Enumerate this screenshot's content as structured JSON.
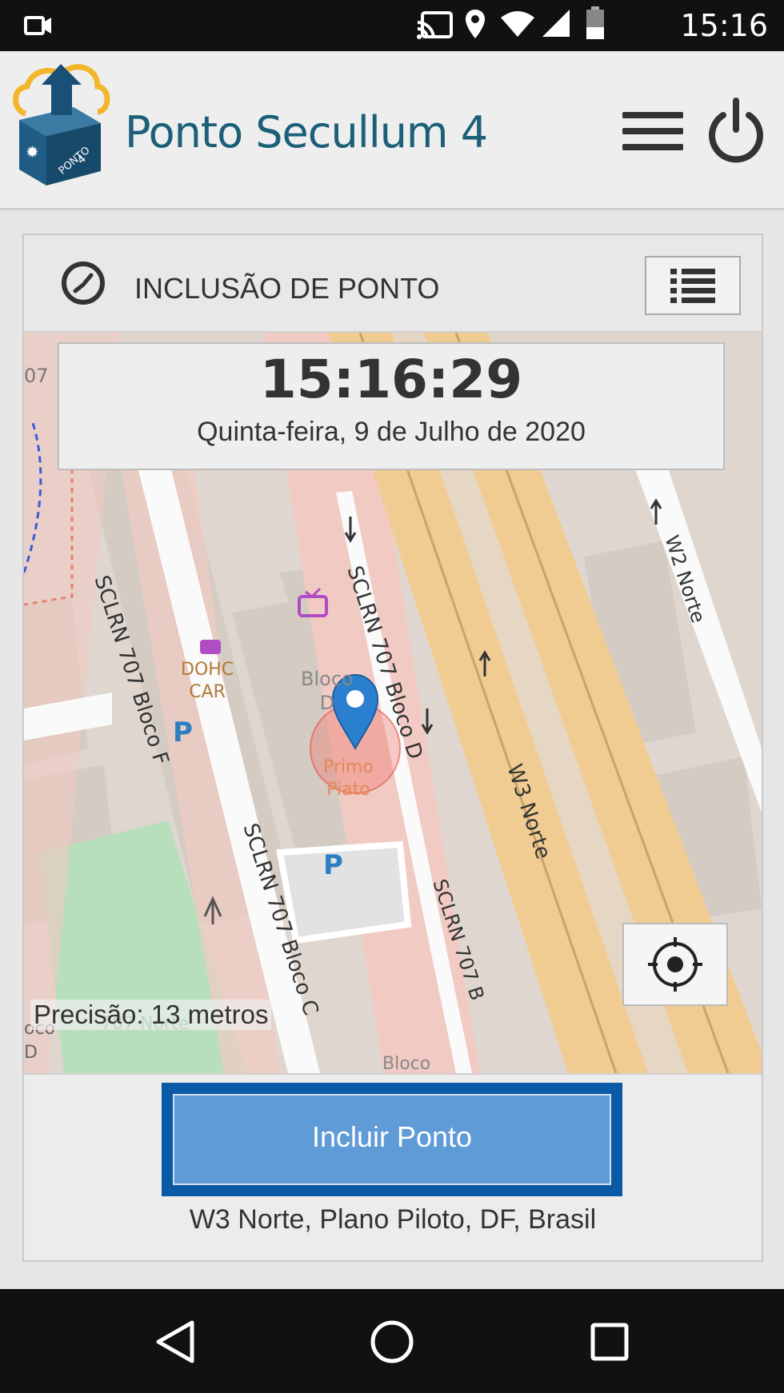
{
  "status_bar": {
    "time": "15:16"
  },
  "header": {
    "title": "Ponto Secullum 4"
  },
  "card": {
    "title": "INCLUSÃO DE PONTO"
  },
  "clock": {
    "time": "15:16:29",
    "date": "Quinta-feira, 9 de Julho de 2020"
  },
  "map": {
    "precision": "Precisão: 13 metros",
    "labels": {
      "road_bloco_f": "SCLRN 707 Bloco F",
      "road_bloco_d": "SCLRN 707 Bloco D",
      "road_bloco_c": "SCLRN 707 Bloco C",
      "road_b": "SCLRN 707 B",
      "w3_norte": "W3 Norte",
      "w2_norte": "W2 Norte",
      "dohc_car": "DOHC\nCAR",
      "primo_piato": "Primo\nPiato",
      "bloco_d": "Bloco\nD",
      "norte_707": "707 Norte",
      "bloco_left": "oco\nD",
      "num_07": "07",
      "parking": "P",
      "bloco_bottom": "Bloco"
    }
  },
  "actions": {
    "include_button": "Incluir Ponto",
    "address": "W3 Norte, Plano Piloto, DF, Brasil"
  },
  "colors": {
    "brand_blue": "#0b5aa8",
    "button_blue": "#5f9bd6",
    "title_teal": "#1b5f78",
    "marker_blue": "#2b7fcf"
  },
  "icons": [
    "video-icon",
    "cast-icon",
    "location-icon",
    "wifi-icon",
    "signal-icon",
    "battery-icon",
    "menu-icon",
    "power-icon",
    "clock-icon",
    "list-icon",
    "locate-icon",
    "map-marker-icon",
    "back-icon",
    "home-icon",
    "recents-icon"
  ]
}
